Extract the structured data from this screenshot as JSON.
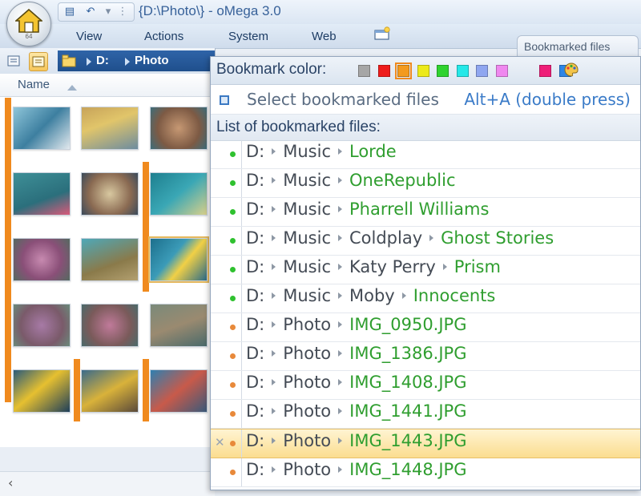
{
  "app": {
    "title": "{D:\\Photo\\} - oMega 3.0",
    "orb_number": "64"
  },
  "menu": [
    "View",
    "Actions",
    "System",
    "Web"
  ],
  "address": [
    "D:",
    "Photo"
  ],
  "pane": {
    "column_name": "Name"
  },
  "bookmarks": {
    "tab_label": "Bookmarked files",
    "color_label": "Bookmark color:",
    "colors": [
      "#a6a6a6",
      "#ee1c1c",
      "#f39a1e",
      "#ecea1a",
      "#2fd32f",
      "#25e8e8",
      "#8fa6f0",
      "#ef88ef",
      "#ee1e78",
      "#2e86e6"
    ],
    "selected_color_index": 2,
    "select_label": "Select bookmarked files",
    "select_shortcut": "Alt+A (double press)",
    "list_heading": "List of bookmarked files:",
    "entries": [
      {
        "path": [
          "D:",
          "Music"
        ],
        "name": "Lorde",
        "color": "#2fc12f"
      },
      {
        "path": [
          "D:",
          "Music"
        ],
        "name": "OneRepublic",
        "color": "#2fc12f"
      },
      {
        "path": [
          "D:",
          "Music"
        ],
        "name": "Pharrell Williams",
        "color": "#2fc12f"
      },
      {
        "path": [
          "D:",
          "Music",
          "Coldplay"
        ],
        "name": "Ghost Stories",
        "color": "#2fc12f"
      },
      {
        "path": [
          "D:",
          "Music",
          "Katy Perry"
        ],
        "name": "Prism",
        "color": "#2fc12f"
      },
      {
        "path": [
          "D:",
          "Music",
          "Moby"
        ],
        "name": "Innocents",
        "color": "#2fc12f"
      },
      {
        "path": [
          "D:",
          "Photo"
        ],
        "name": "IMG_0950.JPG",
        "color": "#e8893a"
      },
      {
        "path": [
          "D:",
          "Photo"
        ],
        "name": "IMG_1386.JPG",
        "color": "#e8893a"
      },
      {
        "path": [
          "D:",
          "Photo"
        ],
        "name": "IMG_1408.JPG",
        "color": "#e8893a"
      },
      {
        "path": [
          "D:",
          "Photo"
        ],
        "name": "IMG_1441.JPG",
        "color": "#e8893a"
      },
      {
        "path": [
          "D:",
          "Photo"
        ],
        "name": "IMG_1443.JPG",
        "color": "#e8893a",
        "highlight": true
      },
      {
        "path": [
          "D:",
          "Photo"
        ],
        "name": "IMG_1448.JPG",
        "color": "#e8893a"
      }
    ]
  }
}
